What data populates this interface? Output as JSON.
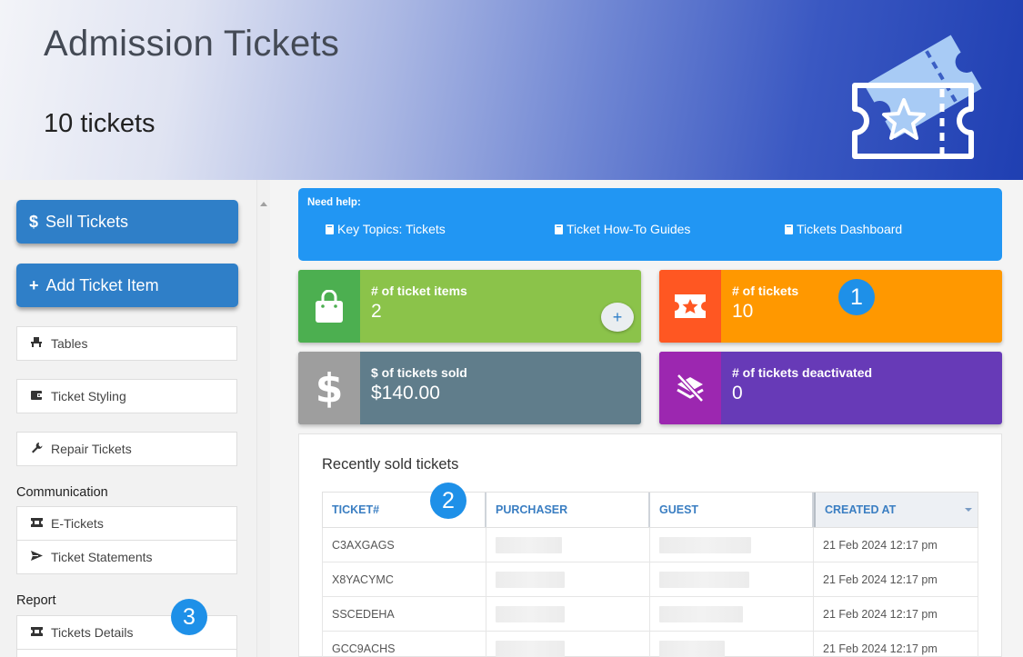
{
  "header": {
    "title": "Admission Tickets",
    "count_text": "10 tickets"
  },
  "sidebar": {
    "sell_button": {
      "icon": "dollar-icon",
      "icon_glyph": "$",
      "label": "Sell Tickets"
    },
    "add_button": {
      "icon": "plus-icon",
      "icon_glyph": "+",
      "label": "Add Ticket Item"
    },
    "items": [
      {
        "label": "Tables",
        "icon": "chair-icon"
      },
      {
        "label": "Ticket Styling",
        "icon": "wallet-icon"
      },
      {
        "label": "Repair Tickets",
        "icon": "wrench-icon"
      }
    ],
    "communication_heading": "Communication",
    "communication_items": [
      {
        "label": "E-Tickets",
        "icon": "ticket-icon"
      },
      {
        "label": "Ticket Statements",
        "icon": "paper-plane-icon"
      }
    ],
    "report_heading": "Report",
    "report_items": [
      {
        "label": "Tickets Details",
        "icon": "ticket-icon"
      }
    ]
  },
  "badges": [
    "1",
    "2",
    "3"
  ],
  "help": {
    "label": "Need help:",
    "links": [
      "Key Topics: Tickets",
      "Ticket How-To Guides",
      "Tickets Dashboard"
    ]
  },
  "stats": [
    {
      "label": "# of ticket items",
      "value": "2",
      "icon": "shopping-bag-icon",
      "color": "#8bc34a",
      "icon_bg": "#4caf50"
    },
    {
      "label": "# of tickets",
      "value": "10",
      "icon": "ticket-star-icon",
      "color": "#ff9800",
      "icon_bg": "#ff5722"
    },
    {
      "label": "$ of tickets sold",
      "value": "$140.00",
      "icon": "dollar-icon",
      "color": "#607d8b",
      "icon_bg": "#9e9e9e"
    },
    {
      "label": "# of tickets deactivated",
      "value": "0",
      "icon": "layers-off-icon",
      "color": "#673ab7",
      "icon_bg": "#9c27b0"
    }
  ],
  "recent": {
    "title": "Recently sold tickets",
    "columns": [
      "TICKET#",
      "PURCHASER",
      "GUEST",
      "CREATED AT"
    ],
    "rows": [
      {
        "ticket": "C3AXGAGS",
        "created": "21 Feb 2024 12:17 pm"
      },
      {
        "ticket": "X8YACYMC",
        "created": "21 Feb 2024 12:17 pm"
      },
      {
        "ticket": "SSCEDEHA",
        "created": "21 Feb 2024 12:17 pm"
      },
      {
        "ticket": "GCC9ACHS",
        "created": "21 Feb 2024 12:17 pm"
      }
    ]
  },
  "colors": {
    "accent": "#2f7fc8",
    "help_bg": "#2196f3",
    "badge": "#1e90e8"
  }
}
